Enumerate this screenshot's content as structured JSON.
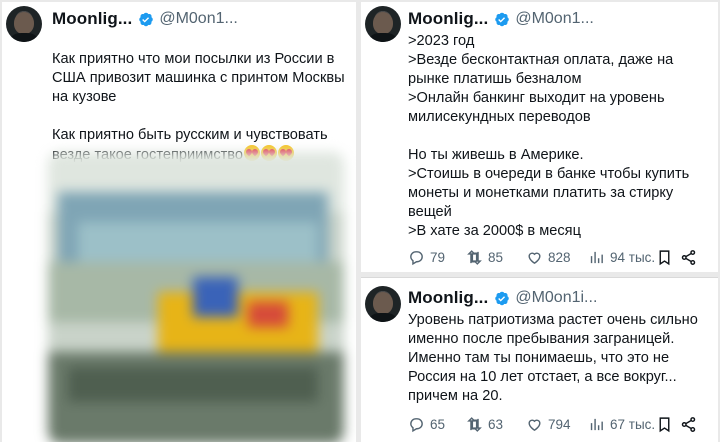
{
  "tweets": [
    {
      "author": "Moonlig...",
      "handle": "@M0on1...",
      "text": "Как приятно что мои посылки из России в\nСША привозит машинка с принтом Москвы\nна кузове\n\nКак приятно быть русским и чувствовать\nвезде такое гостеприимство"
    },
    {
      "author": "Moonlig...",
      "handle": "@M0on1...",
      "text": ">2023 год\n>Везде бесконтактная оплата, даже на\nрынке платишь безналом\n>Онлайн банкинг выходит на уровень\nмилисекундных переводов\n\nНо ты живешь в Америке.\n>Стоишь в очереди в банке чтобы купить\nмонеты и монетками платить за стирку\nвещей\n>В хате за 2000$ в месяц",
      "replies": "79",
      "retweets": "85",
      "likes": "828",
      "views": "94 тыс."
    },
    {
      "author": "Moonlig...",
      "handle": "@M0on1i...",
      "text": "Уровень патриотизма растет очень сильно\nименно после пребывания заграницей.\nИменно там ты понимаешь, что это не\nРоссия на 10 лет отстает, а все вокруг...\nпричем на 20.",
      "replies": "65",
      "retweets": "63",
      "likes": "794",
      "views": "67 тыс."
    }
  ],
  "colors": {
    "verified": "#1d9bf0",
    "muted": "#536471",
    "text": "#0f1419"
  },
  "icons": [
    "verified-badge-icon",
    "reply-icon",
    "retweet-icon",
    "like-icon",
    "views-icon",
    "bookmark-icon",
    "share-icon",
    "heart-eyes-emoji"
  ]
}
